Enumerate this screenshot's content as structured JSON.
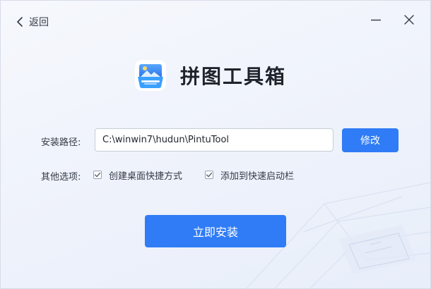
{
  "header": {
    "back_label": "返回"
  },
  "brand": {
    "title": "拼图工具箱",
    "icon": "pintu-toolbox-logo"
  },
  "install_path": {
    "label": "安装路径:",
    "value": "C:\\winwin7\\hudun\\PintuTool",
    "modify_label": "修改"
  },
  "options": {
    "label": "其他选项:",
    "items": [
      {
        "label": "创建桌面快捷方式",
        "checked": true
      },
      {
        "label": "添加到快速启动栏",
        "checked": true
      }
    ]
  },
  "install_button_label": "立即安装",
  "colors": {
    "accent": "#2f7cf6",
    "text": "#333a46",
    "title": "#1f232b"
  }
}
